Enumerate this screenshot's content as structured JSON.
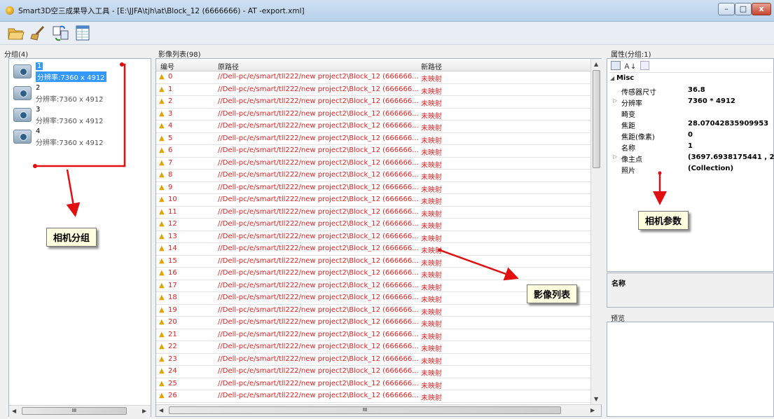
{
  "window": {
    "title": "Smart3D空三成果导入工具 - [E:\\JJFA\\tjh\\at\\Block_12 (6666666) - AT -export.xml]",
    "controls": {
      "minimize": "–",
      "maximize": "□",
      "close": "x"
    }
  },
  "toolbar": {
    "icons": [
      "open-folder-icon",
      "clear-broom-icon",
      "convert-icon",
      "export-table-icon"
    ]
  },
  "groups": {
    "label": "分组(4)",
    "items": [
      {
        "name": "1",
        "resolution": "分辨率:7360 x 4912"
      },
      {
        "name": "2",
        "resolution": "分辨率:7360 x 4912"
      },
      {
        "name": "3",
        "resolution": "分辨率:7360 x 4912"
      },
      {
        "name": "4",
        "resolution": "分辨率:7360 x 4912"
      }
    ],
    "scroll_mid": "III"
  },
  "images": {
    "label": "影像列表(98)",
    "columns": [
      "编号",
      "原路径",
      "新路径"
    ],
    "path": "//Dell-pc/e/smart/tll222/new project2\\Block_12 (666666...",
    "status": "未映射",
    "rows": [
      "0",
      "1",
      "2",
      "3",
      "4",
      "5",
      "6",
      "7",
      "8",
      "9",
      "10",
      "11",
      "12",
      "13",
      "14",
      "15",
      "16",
      "17",
      "18",
      "19",
      "20",
      "21",
      "22",
      "23",
      "24",
      "25",
      "26"
    ],
    "scroll_mid": "III"
  },
  "properties": {
    "label": "属性(分组:1)",
    "category": "Misc",
    "rows": [
      {
        "key": "传感器尺寸",
        "value": "36.8",
        "expandable": false
      },
      {
        "key": "分辨率",
        "value": "7360 * 4912",
        "expandable": true
      },
      {
        "key": "畸变",
        "value": "",
        "expandable": false
      },
      {
        "key": "焦距",
        "value": "28.07042835909953",
        "expandable": false
      },
      {
        "key": "焦距(像素)",
        "value": "0",
        "expandable": false
      },
      {
        "key": "名称",
        "value": "1",
        "expandable": false
      },
      {
        "key": "像主点",
        "value": "(3697.6938175441 , 2460",
        "expandable": true
      },
      {
        "key": "照片",
        "value": "(Collection)",
        "expandable": false
      }
    ],
    "description_title": "名称",
    "preview_label": "预览"
  },
  "annotations": {
    "camera_group": "相机分组",
    "image_list": "影像列表",
    "camera_params": "相机参数"
  },
  "colors": {
    "annotation_red": "#e01010",
    "row_text": "#e02020",
    "warning": "#e1a400",
    "selection": "#3399ff"
  }
}
